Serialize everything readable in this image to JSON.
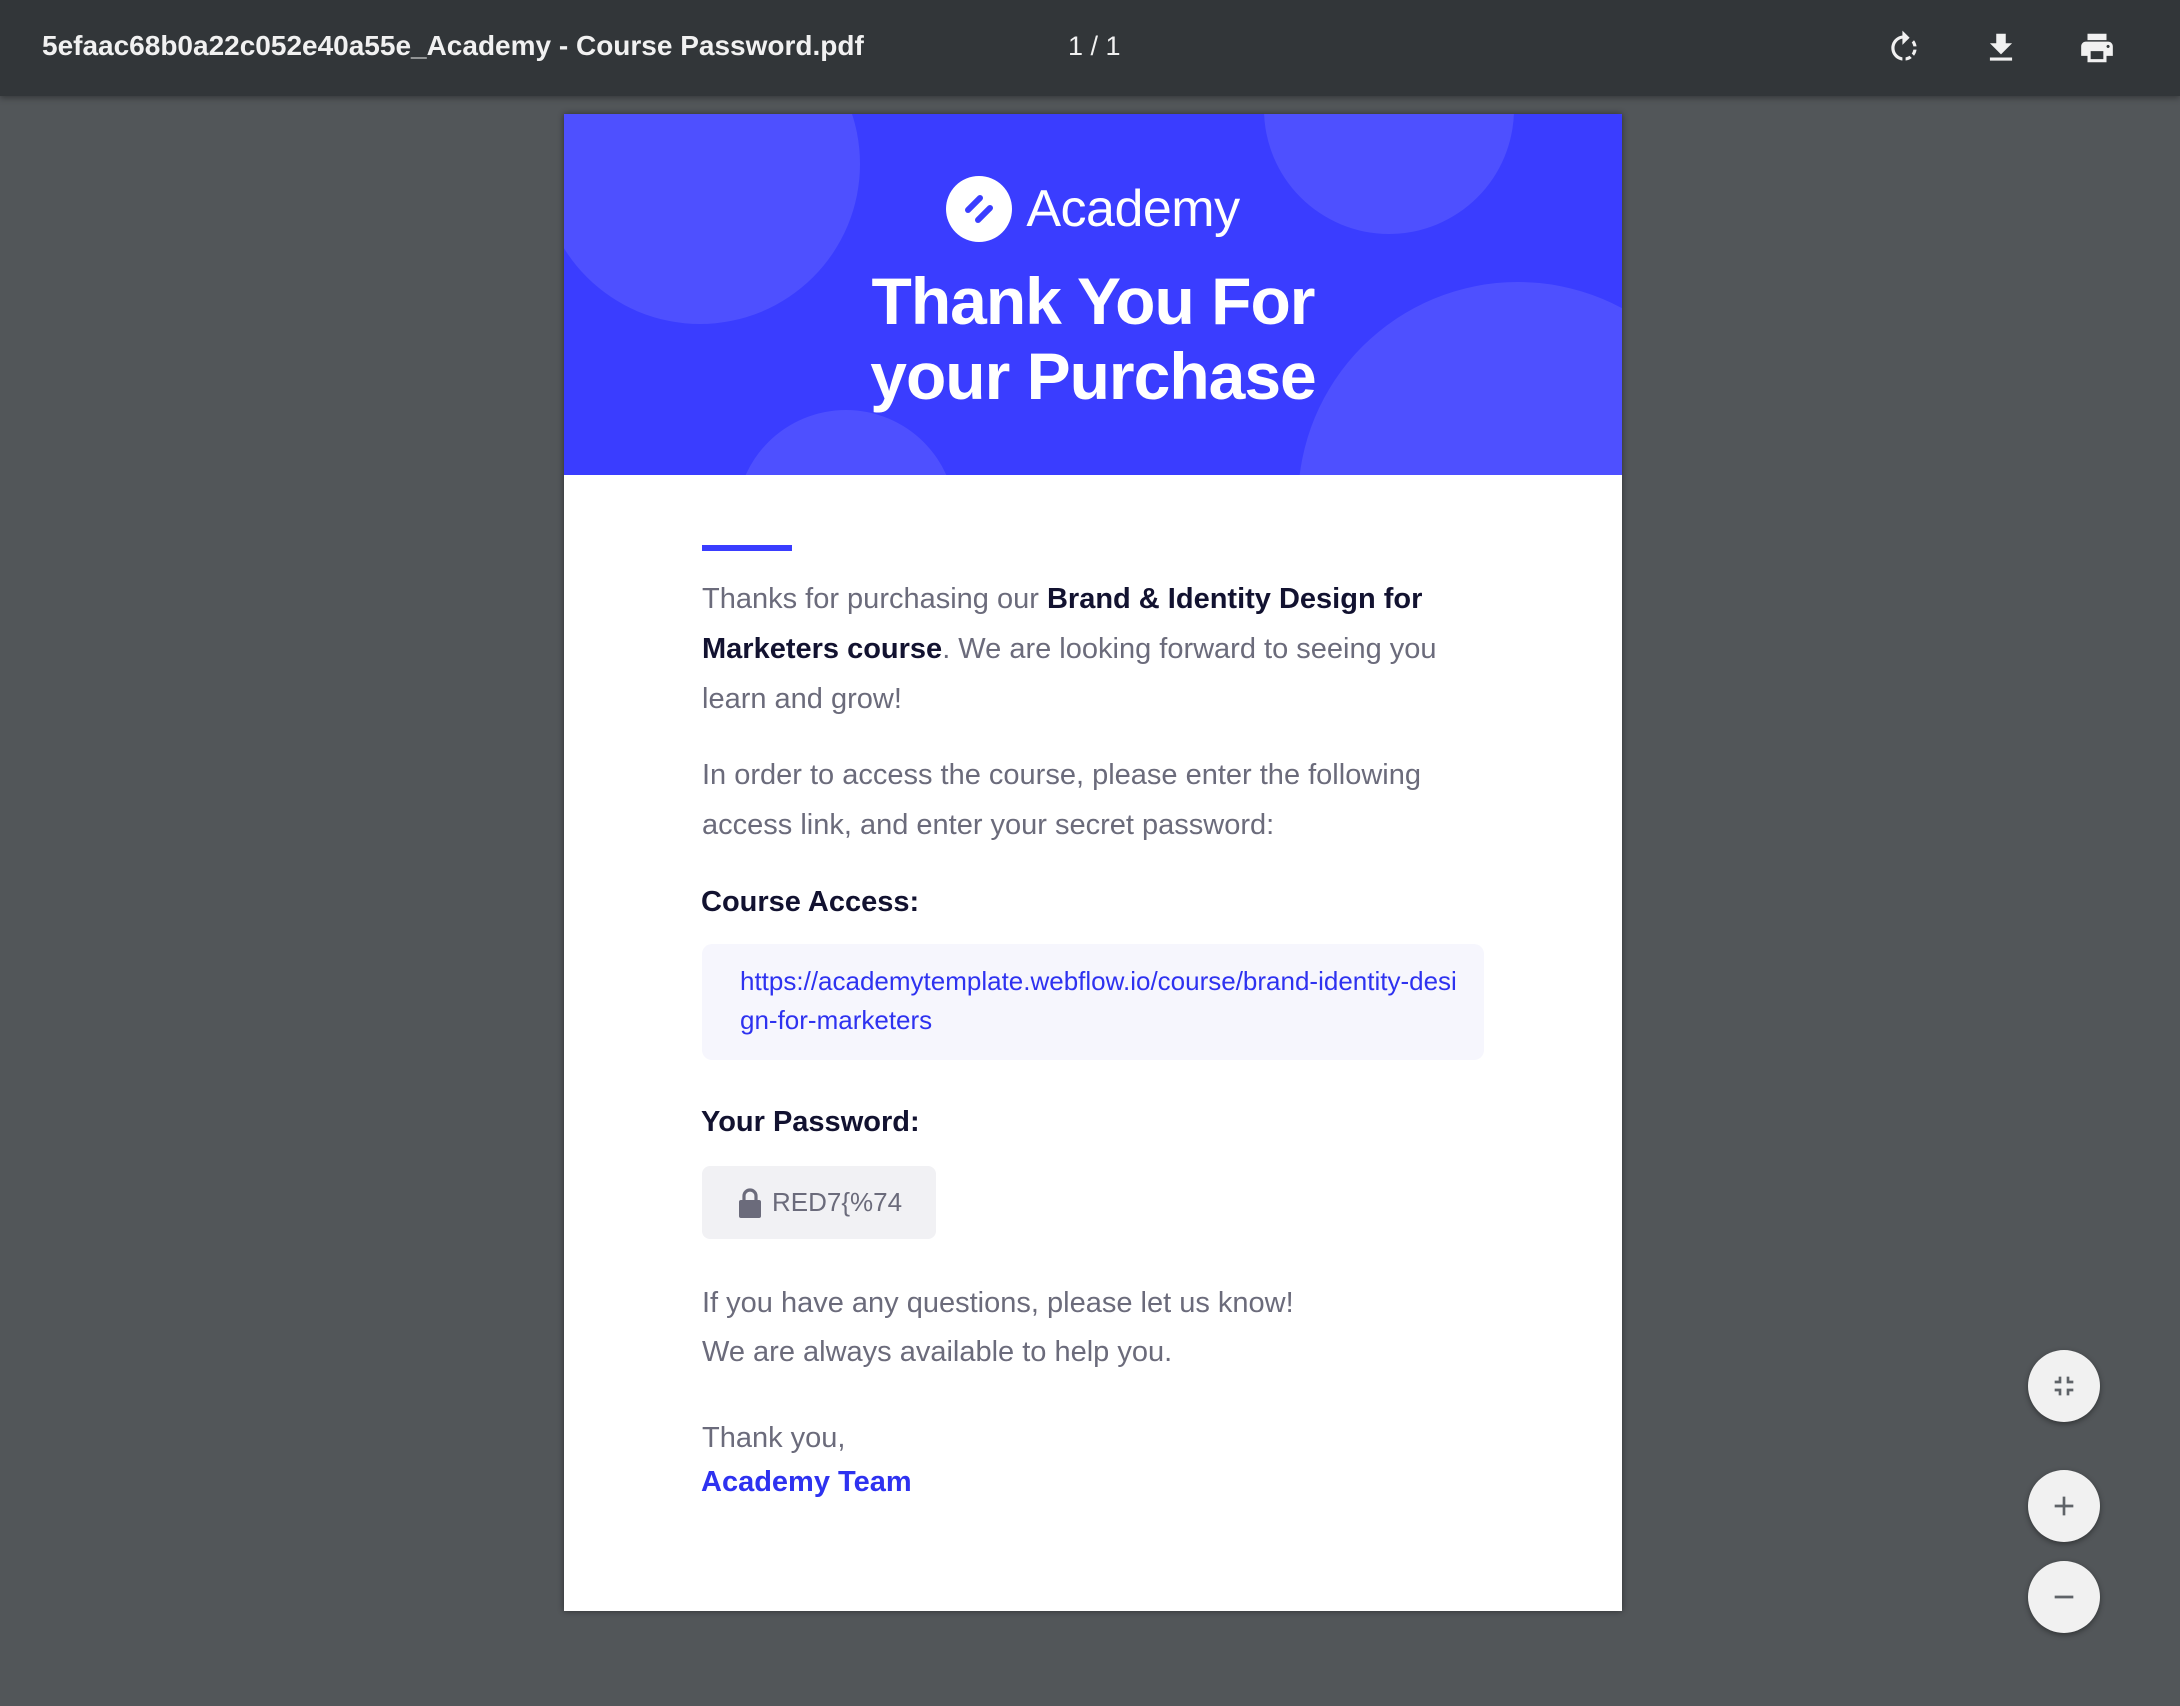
{
  "toolbar": {
    "filename": "5efaac68b0a22c052e40a55e_Academy - Course Password.pdf",
    "page_indicator": "1 / 1",
    "rotate_icon": "rotate-icon",
    "download_icon": "download-icon",
    "print_icon": "print-icon"
  },
  "document": {
    "brand": "Academy",
    "title": "Thank You For your Purchase",
    "intro_plain_1": "Thanks for purchasing our ",
    "intro_bold": "Brand & Identity Design for Marketers course",
    "intro_plain_2": ". We are looking forward to seeing you learn and grow!",
    "instructions": "In order to access the course, please enter the following access link, and enter your secret password:",
    "course_access_label": "Course Access:",
    "course_access_link": "https://academytemplate.webflow.io/course/brand-identity-design-for-marketers",
    "password_label": "Your Password:",
    "password_value": "RED7{%74",
    "questions_line_1": "If you have any questions, please let us know!",
    "questions_line_2": "We are always available to help you.",
    "sign_off": "Thank you,",
    "team_name": "Academy Team"
  },
  "controls": {
    "fit_icon": "fit-to-page-icon",
    "zoom_in_icon": "zoom-in-icon",
    "zoom_out_icon": "zoom-out-icon"
  },
  "colors": {
    "brand_blue": "#3a3dff",
    "link_blue": "#2e32f0",
    "viewer_bg": "#525659",
    "toolbar_bg": "#323639"
  }
}
